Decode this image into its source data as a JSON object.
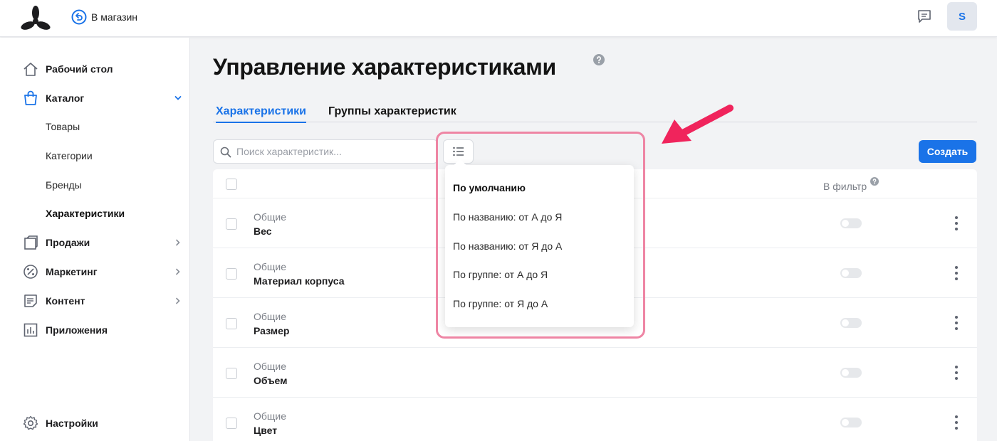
{
  "header": {
    "back_label": "В магазин",
    "avatar_initial": "S"
  },
  "sidebar": {
    "items": [
      {
        "label": "Рабочий стол",
        "icon": "home-icon"
      },
      {
        "label": "Каталог",
        "icon": "shopping-bag-icon",
        "expanded": true
      },
      {
        "label": "Продажи",
        "icon": "sales-icon"
      },
      {
        "label": "Маркетинг",
        "icon": "percent-icon"
      },
      {
        "label": "Контент",
        "icon": "document-icon"
      },
      {
        "label": "Приложения",
        "icon": "chart-icon"
      }
    ],
    "catalog_subitems": [
      "Товары",
      "Категории",
      "Бренды",
      "Характеристики"
    ],
    "active_subitem": "Характеристики",
    "settings_label": "Настройки"
  },
  "main": {
    "title": "Управление характеристиками",
    "tabs": [
      {
        "label": "Характеристики",
        "active": true
      },
      {
        "label": "Группы характеристик",
        "active": false
      }
    ],
    "search_placeholder": "Поиск характеристик...",
    "create_label": "Создать",
    "filter_column_label": "В фильтр"
  },
  "table": {
    "rows": [
      {
        "group": "Общие",
        "name": "Вес",
        "in_filter": false
      },
      {
        "group": "Общие",
        "name": "Материал корпуса",
        "in_filter": false
      },
      {
        "group": "Общие",
        "name": "Размер",
        "in_filter": false
      },
      {
        "group": "Общие",
        "name": "Объем",
        "in_filter": false
      },
      {
        "group": "Общие",
        "name": "Цвет",
        "in_filter": false
      }
    ]
  },
  "sort_dropdown": {
    "selected": "По умолчанию",
    "options": [
      "По умолчанию",
      "По названию: от А до Я",
      "По названию: от Я до А",
      "По группе: от А до Я",
      "По группе: от Я до А"
    ]
  },
  "colors": {
    "accent": "#1a73e8",
    "highlight": "#ee85a4",
    "arrow": "#f0245c"
  }
}
